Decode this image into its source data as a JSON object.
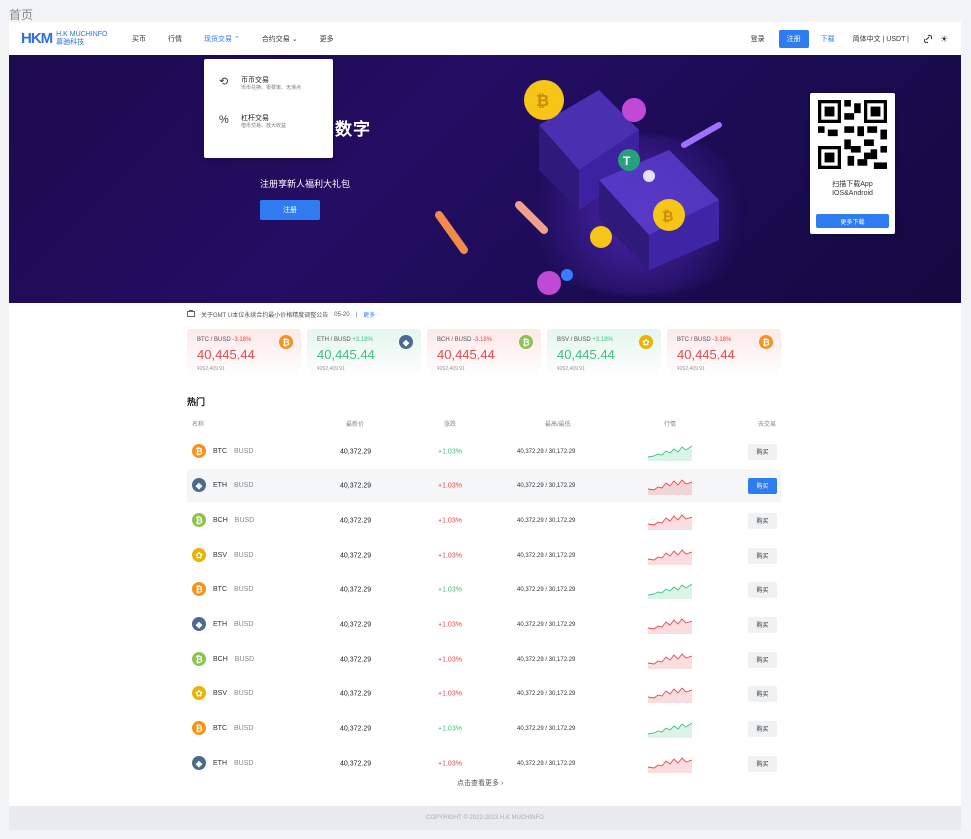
{
  "page_label": "首页",
  "header": {
    "logo_mark": "HKM",
    "logo_text_1": "H.K MUCHINFO",
    "logo_text_2": "慕驰科技",
    "nav": [
      "买币",
      "行情",
      "现货交易 ⌃",
      "合约交易 ⌄",
      "更多"
    ],
    "login": "登录",
    "register": "注册",
    "download": "下载",
    "lang_currency": "简体中文 | USDT |"
  },
  "banner": {
    "title": "数字",
    "subtitle": "注册享新人福利大礼包",
    "button": "注册",
    "qr_line1": "扫描下载App",
    "qr_line2": "IOS&Android",
    "qr_more": "更多下载"
  },
  "dropdown": {
    "items": [
      {
        "title": "币币交易",
        "sub": "币币兑换、零费率、无滑点"
      },
      {
        "title": "杠杆交易",
        "sub": "借币交易、放大收益"
      }
    ]
  },
  "notice": {
    "text": "关于GMT U本位永续合约最小价格精度调整公告",
    "date": "05-20",
    "sep": "|",
    "more": "更多"
  },
  "cards": [
    {
      "pair": "BTC / BUSD",
      "change": "-3.18%",
      "trend": "red",
      "price": "40,445.44",
      "cny": "¥262,409.91",
      "coin": "btc"
    },
    {
      "pair": "ETH / BUSD",
      "change": "+3.18%",
      "trend": "green",
      "price": "40,445.44",
      "cny": "¥262,409.91",
      "coin": "eth"
    },
    {
      "pair": "BCH / BUSD",
      "change": "-3.18%",
      "trend": "red",
      "price": "40,445.44",
      "cny": "¥262,409.91",
      "coin": "bch"
    },
    {
      "pair": "BSV / BUSD",
      "change": "+3.18%",
      "trend": "green",
      "price": "40,445.44",
      "cny": "¥262,409.91",
      "coin": "bsv"
    },
    {
      "pair": "BTC / BUSD",
      "change": "-3.18%",
      "trend": "red",
      "price": "40,445.44",
      "cny": "¥262,409.91",
      "coin": "btc"
    }
  ],
  "hot": {
    "title": "热门",
    "columns": [
      "名称",
      "最新价",
      "涨跌",
      "最高/最低",
      "行情",
      "去交易"
    ],
    "rows": [
      {
        "base": "BTC",
        "quote": "BUSD",
        "coin": "btc",
        "last": "40,372.29",
        "change": "+1.03%",
        "trend": "green",
        "hl": "40,372.29 / 30,172.29",
        "action": "购买"
      },
      {
        "base": "ETH",
        "quote": "BUSD",
        "coin": "eth",
        "last": "40,372.29",
        "change": "+1.03%",
        "trend": "red",
        "hl": "40,372.29 / 30,172.29",
        "action": "购买",
        "highlight": true
      },
      {
        "base": "BCH",
        "quote": "BUSD",
        "coin": "bch",
        "last": "40,372.29",
        "change": "+1.03%",
        "trend": "red",
        "hl": "40,372.29 / 30,172.29",
        "action": "购买"
      },
      {
        "base": "BSV",
        "quote": "BUSD",
        "coin": "bsv",
        "last": "40,372.29",
        "change": "+1.03%",
        "trend": "red",
        "hl": "40,372.29 / 30,172.29",
        "action": "购买"
      },
      {
        "base": "BTC",
        "quote": "BUSD",
        "coin": "btc",
        "last": "40,372.29",
        "change": "+1.03%",
        "trend": "green",
        "hl": "40,372.29 / 30,172.29",
        "action": "购买"
      },
      {
        "base": "ETH",
        "quote": "BUSD",
        "coin": "eth",
        "last": "40,372.29",
        "change": "+1.03%",
        "trend": "red",
        "hl": "40,372.29 / 30,172.29",
        "action": "购买"
      },
      {
        "base": "BCH",
        "quote": "BUSD",
        "coin": "bch",
        "last": "40,372.29",
        "change": "+1.03%",
        "trend": "red",
        "hl": "40,372.29 / 30,172.29",
        "action": "购买"
      },
      {
        "base": "BSV",
        "quote": "BUSD",
        "coin": "bsv",
        "last": "40,372.29",
        "change": "+1.03%",
        "trend": "red",
        "hl": "40,372.29 / 30,172.29",
        "action": "购买"
      },
      {
        "base": "BTC",
        "quote": "BUSD",
        "coin": "btc",
        "last": "40,372.29",
        "change": "+1.03%",
        "trend": "green",
        "hl": "40,372.29 / 30,172.29",
        "action": "购买"
      },
      {
        "base": "ETH",
        "quote": "BUSD",
        "coin": "eth",
        "last": "40,372.29",
        "change": "+1.03%",
        "trend": "red",
        "hl": "40,372.29 / 30,172.29",
        "action": "购买"
      }
    ],
    "more": "点击查看更多 ›"
  },
  "footer": "COPYRIGHT © 2022-2023 H.K MUCHINFO",
  "colors": {
    "accent": "#2f7bf0",
    "up": "#3fbf7f",
    "down": "#e5484d",
    "btc": "#f7931a",
    "eth": "#4a6a8f",
    "bch": "#8dc351",
    "bsv": "#eab300"
  }
}
